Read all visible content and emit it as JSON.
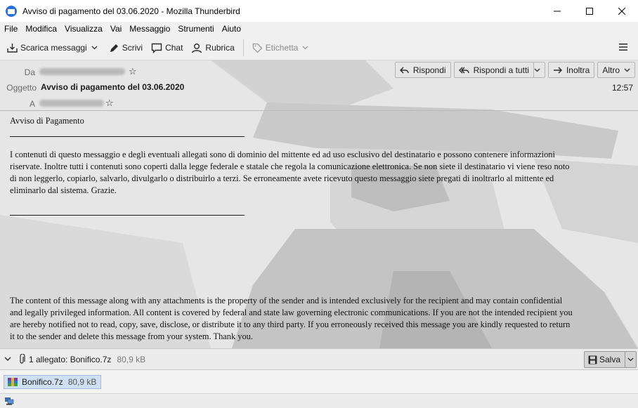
{
  "window": {
    "title": "Avviso di pagamento del 03.06.2020 - Mozilla Thunderbird",
    "controls": {
      "minimize": "—",
      "maximize": "☐",
      "close": "✕"
    }
  },
  "menu": [
    "File",
    "Modifica",
    "Visualizza",
    "Vai",
    "Messaggio",
    "Strumenti",
    "Aiuto"
  ],
  "toolbar": {
    "get_messages": "Scarica messaggi",
    "write": "Scrivi",
    "chat": "Chat",
    "address_book": "Rubrica",
    "tag": "Etichetta"
  },
  "header": {
    "from_label": "Da",
    "subject_label": "Oggetto",
    "subject": "Avviso di pagamento del 03.06.2020",
    "to_label": "A",
    "time": "12:57",
    "actions": {
      "reply": "Rispondi",
      "reply_all": "Rispondi a tutti",
      "forward": "Inoltra",
      "more": "Altro"
    }
  },
  "body": {
    "greeting": "Avviso di Pagamento",
    "italian_lines": [
      "I contenuti di questo messaggio e degli eventuali allegati sono di dominio del mittente ed ad uso esclusivo del destinatario e possono contenere informazioni",
      "riservate. Inoltre tutti i contenuti sono coperti dalla legge federale e statale che regola la comunicazione elettronica. Se non siete il destinatario vi viene reso noto",
      "di non leggerlo, copiarlo, salvarlo, divulgarlo o distribuirlo a terzi. Se erroneamente avete ricevuto questo messaggio siete pregati di inoltrarlo al mittente ed",
      "eliminarlo dal sistema. Grazie."
    ],
    "english_lines": [
      "The content of this message along with any attachments is the property of the sender and is intended exclusively for the recipient and may contain confidential",
      "and legally privileged information. All content is covered by federal and state law governing electronic communications. If you are not the intended recipient you",
      "are hereby notified not to read, copy, save, disclose, or distribute it to any third party. If you erroneously received this message you are kindly requested to return",
      "it to the sender and delete this message from your system. Thank you."
    ]
  },
  "attachments": {
    "summary": "1 allegato: Bonifico.7z",
    "summary_size": "80,9 kB",
    "save_label": "Salva",
    "files": [
      {
        "name": "Bonifico.7z",
        "size": "80,9 kB"
      }
    ]
  }
}
